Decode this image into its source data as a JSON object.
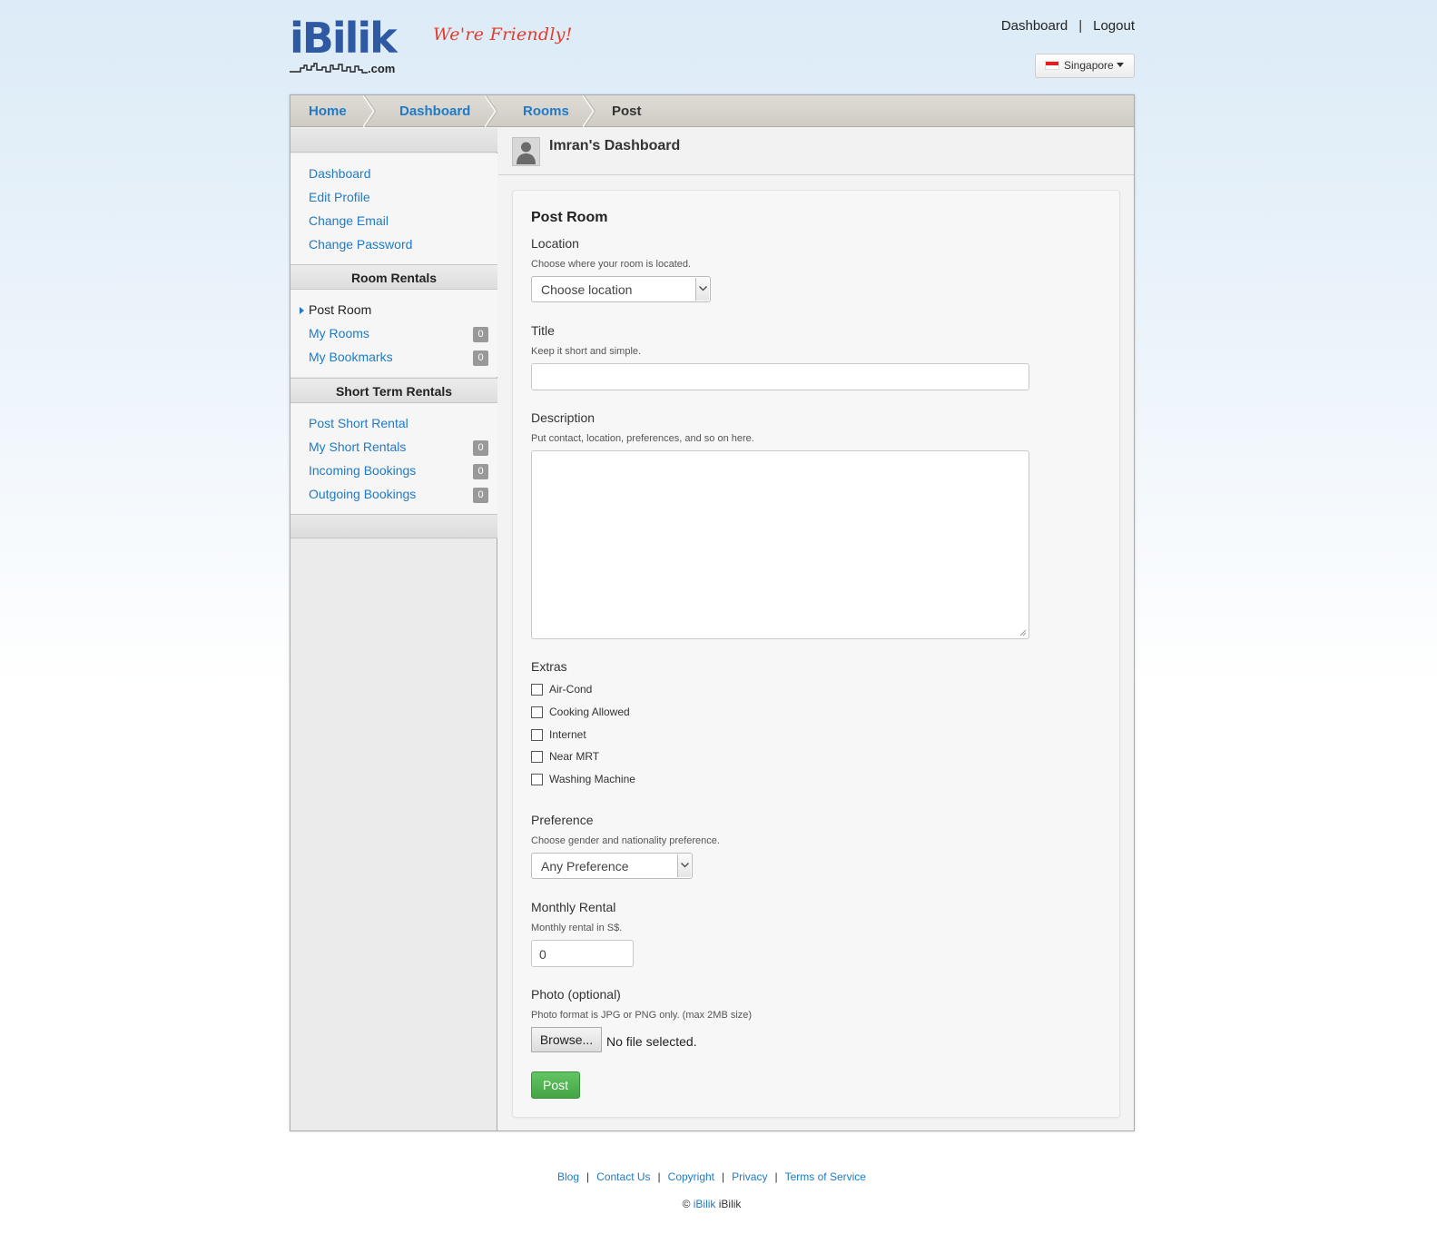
{
  "header": {
    "logo_text": "iBilik",
    "logo_tld": ".com",
    "tagline": "We're Friendly!",
    "nav": {
      "dashboard": "Dashboard",
      "separator": "|",
      "logout": "Logout"
    },
    "country": {
      "label": "Singapore",
      "flag_icon": "singapore-flag-icon"
    }
  },
  "breadcrumb": {
    "home": "Home",
    "dashboard": "Dashboard",
    "rooms": "Rooms",
    "current": "Post"
  },
  "sidebar": {
    "account_links": {
      "dashboard": "Dashboard",
      "edit_profile": "Edit Profile",
      "change_email": "Change Email",
      "change_password": "Change Password"
    },
    "room_rentals": {
      "heading": "Room Rentals",
      "post_room": "Post Room",
      "my_rooms": "My Rooms",
      "my_rooms_count": "0",
      "my_bookmarks": "My Bookmarks",
      "my_bookmarks_count": "0"
    },
    "short_term": {
      "heading": "Short Term Rentals",
      "post_short_rental": "Post Short Rental",
      "my_short_rentals": "My Short Rentals",
      "my_short_rentals_count": "0",
      "incoming_bookings": "Incoming Bookings",
      "incoming_bookings_count": "0",
      "outgoing_bookings": "Outgoing Bookings",
      "outgoing_bookings_count": "0"
    }
  },
  "dashboard_title": "Imran's Dashboard",
  "form": {
    "title": "Post Room",
    "location": {
      "label": "Location",
      "help": "Choose where your room is located.",
      "value": "Choose location"
    },
    "title_field": {
      "label": "Title",
      "help": "Keep it short and simple.",
      "value": ""
    },
    "description": {
      "label": "Description",
      "help": "Put contact, location, preferences, and so on here.",
      "value": ""
    },
    "extras": {
      "label": "Extras",
      "options": [
        "Air-Cond",
        "Cooking Allowed",
        "Internet",
        "Near MRT",
        "Washing Machine"
      ]
    },
    "preference": {
      "label": "Preference",
      "help": "Choose gender and nationality preference.",
      "value": "Any Preference"
    },
    "monthly_rental": {
      "label": "Monthly Rental",
      "help": "Monthly rental in S$.",
      "value": "0"
    },
    "photo": {
      "label": "Photo (optional)",
      "help": "Photo format is JPG or PNG only. (max 2MB size)",
      "browse_label": "Browse...",
      "status": "No file selected."
    },
    "submit_label": "Post"
  },
  "footer": {
    "links": [
      "Blog",
      "Contact Us",
      "Copyright",
      "Privacy",
      "Terms of Service"
    ],
    "separator": "|",
    "copyright_symbol": "©",
    "copyright_link": "iBilik",
    "copyright_name": "iBilik"
  },
  "colors": {
    "link": "#1f7ac7",
    "brand": "#2f5aa3",
    "tagline": "#e23c2b",
    "post_button": "#4cae4c"
  }
}
